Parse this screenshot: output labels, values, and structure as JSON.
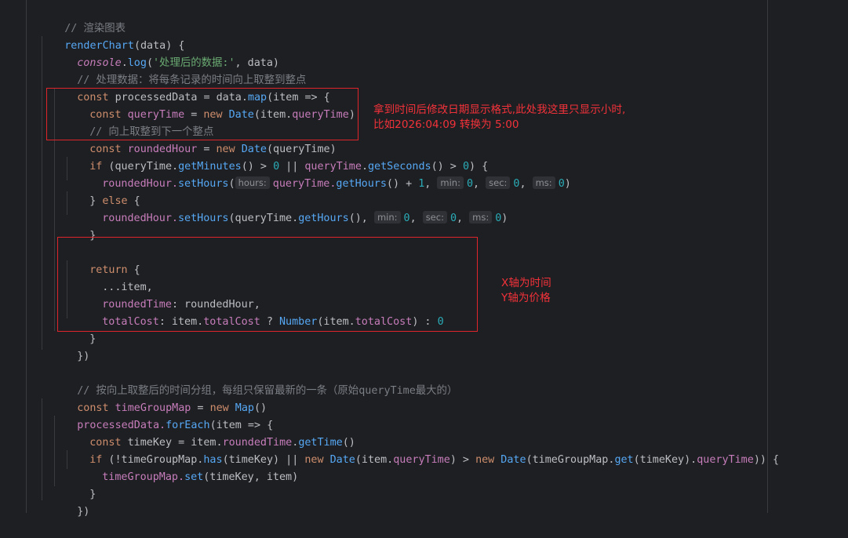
{
  "code": {
    "l1_comment": "// 渲染图表",
    "l2_fn": "renderChart",
    "l2_open": "(data) {",
    "l3_console": "console",
    "l3_dot": ".",
    "l3_log": "log",
    "l3_paren": "(",
    "l3_str": "'处理后的数据:'",
    "l3_rest": ", data)",
    "l4_comment": "// 处理数据：将每条记录的时间向上取整到整点",
    "l5_const": "const",
    "l5_var": " processedData = data.",
    "l5_map": "map",
    "l5_rest": "(item => {",
    "l6_const": "const",
    "l6_var": " queryTime",
    "l6_eq": " = ",
    "l6_new": "new",
    "l6_date": " Date",
    "l6_arg": "(item.",
    "l6_prop": "queryTime",
    "l6_close": ")",
    "l7_comment": "// 向上取整到下一个整点",
    "l8_const": "const",
    "l8_var": " roundedHour",
    "l8_eq": " = ",
    "l8_new": "new",
    "l8_date": " Date",
    "l8_arg": "(queryTime)",
    "l9_if": "if",
    "l9_a": " (queryTime.",
    "l9_getmin": "getMinutes",
    "l9_b": "() > ",
    "l9_zero1": "0",
    "l9_or": " || ",
    "l9_qt": "queryTime",
    "l9_c": ".",
    "l9_getsec": "getSeconds",
    "l9_d": "() > ",
    "l9_zero2": "0",
    "l9_e": ") {",
    "l10_var": "roundedHour.",
    "l10_set": "setHours",
    "l10_paren": "(",
    "l10_hint_hours": "hours:",
    "l10_qt": "queryTime.",
    "l10_get": "getHours",
    "l10_plus": "() + ",
    "l10_one": "1",
    "l10_comma1": ", ",
    "l10_hint_min": "min:",
    "l10_zero1": "0",
    "l10_comma2": ", ",
    "l10_hint_sec": "sec:",
    "l10_zero2": "0",
    "l10_comma3": ", ",
    "l10_hint_ms": "ms:",
    "l10_zero3": "0",
    "l10_close": ")",
    "l11_brace": "} ",
    "l11_else": "else",
    "l11_open": " {",
    "l12_var": "roundedHour.",
    "l12_set": "setHours",
    "l12_a": "(queryTime.",
    "l12_get": "getHours",
    "l12_b": "(), ",
    "l12_hint_min": "min:",
    "l12_zero1": "0",
    "l12_comma1": ", ",
    "l12_hint_sec": "sec:",
    "l12_zero2": "0",
    "l12_comma2": ", ",
    "l12_hint_ms": "ms:",
    "l12_zero3": "0",
    "l12_close": ")",
    "l13": "}",
    "l14_return": "return",
    "l14_open": " {",
    "l15": "...item,",
    "l16_key": "roundedTime",
    "l16_rest": ": roundedHour,",
    "l17_key": "totalCost",
    "l17_a": ": item.",
    "l17_prop": "totalCost",
    "l17_b": " ? ",
    "l17_num": "Number",
    "l17_c": "(item.",
    "l17_prop2": "totalCost",
    "l17_d": ") : ",
    "l17_zero": "0",
    "l18": "}",
    "l19": "})",
    "l20_comment": "// 按向上取整后的时间分组，每组只保留最新的一条（原始queryTime最大的）",
    "l21_const": "const",
    "l21_var": " timeGroupMap",
    "l21_eq": " = ",
    "l21_new": "new",
    "l21_map": " Map",
    "l21_close": "()",
    "l22_var": "processedData.",
    "l22_fe": "forEach",
    "l22_rest": "(item => {",
    "l23_const": "const",
    "l23_var": " timeKey = item.",
    "l23_prop": "roundedTime",
    "l23_dot": ".",
    "l23_gt": "getTime",
    "l23_close": "()",
    "l24_if": "if",
    "l24_a": " (!timeGroupMap.",
    "l24_has": "has",
    "l24_b": "(timeKey) || ",
    "l24_new1": "new",
    "l24_date1": " Date",
    "l24_c": "(item.",
    "l24_prop1": "queryTime",
    "l24_d": ") > ",
    "l24_new2": "new",
    "l24_date2": " Date",
    "l24_e": "(timeGroupMap.",
    "l24_get": "get",
    "l24_f": "(timeKey).",
    "l24_prop2": "queryTime",
    "l24_g": ")) {",
    "l25_var": "timeGroupMap.",
    "l25_set": "set",
    "l25_rest": "(timeKey, item)",
    "l26": "}",
    "l27": "})"
  },
  "annotations": {
    "note1": "拿到时间后修改日期显示格式,此处我这里只显示小时,\n比如2026:04:09 转换为 5:00",
    "note2": "X轴为时间\nY轴为价格"
  },
  "colors": {
    "background": "#1e1f22",
    "keyword": "#cf8e6d",
    "function": "#56a8f5",
    "property": "#c77dbb",
    "string": "#6aab73",
    "number": "#2aacb8",
    "comment": "#7a7e85",
    "annotation": "#e0252a"
  }
}
